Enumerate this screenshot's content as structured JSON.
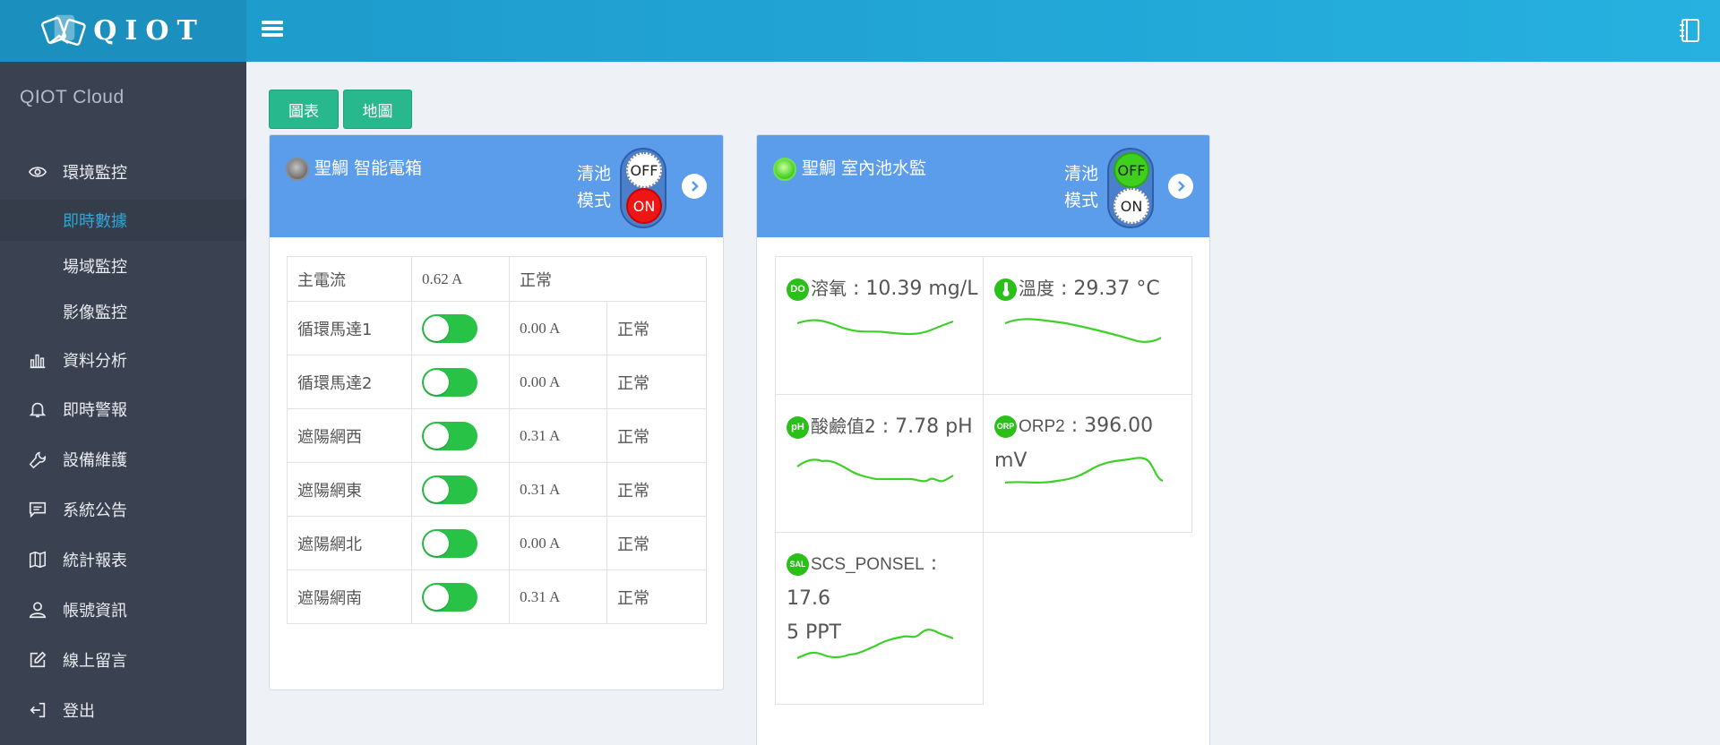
{
  "brand": {
    "name": "QIOT"
  },
  "sidebar": {
    "title": "QIOT Cloud",
    "items": [
      {
        "label": "環境監控",
        "icon": "eye-icon"
      },
      {
        "label": "資料分析",
        "icon": "bar-chart-icon"
      },
      {
        "label": "即時警報",
        "icon": "bell-icon"
      },
      {
        "label": "設備維護",
        "icon": "wrench-icon"
      },
      {
        "label": "系統公告",
        "icon": "message-icon"
      },
      {
        "label": "統計報表",
        "icon": "map-icon"
      },
      {
        "label": "帳號資訊",
        "icon": "user-icon"
      },
      {
        "label": "線上留言",
        "icon": "edit-icon"
      },
      {
        "label": "登出",
        "icon": "logout-icon"
      }
    ],
    "subitems": [
      {
        "label": "即時數據",
        "active": true
      },
      {
        "label": "場域監控",
        "active": false
      },
      {
        "label": "影像監控",
        "active": false
      }
    ]
  },
  "toolbar": {
    "chart_label": "圖表",
    "map_label": "地圖"
  },
  "cards": [
    {
      "title": "聖鯛 智能電箱",
      "status": "gray",
      "mode_label_1": "清池",
      "mode_label_2": "模式",
      "off_label": "OFF",
      "on_label": "ON",
      "main_row": {
        "name": "主電流",
        "value": "0.62 A",
        "status": "正常"
      },
      "rows": [
        {
          "name": "循環馬達1",
          "on": true,
          "value": "0.00 A",
          "status": "正常"
        },
        {
          "name": "循環馬達2",
          "on": true,
          "value": "0.00 A",
          "status": "正常"
        },
        {
          "name": "遮陽網西",
          "on": true,
          "value": "0.31 A",
          "status": "正常"
        },
        {
          "name": "遮陽網東",
          "on": true,
          "value": "0.31 A",
          "status": "正常"
        },
        {
          "name": "遮陽網北",
          "on": true,
          "value": "0.00 A",
          "status": "正常"
        },
        {
          "name": "遮陽網南",
          "on": true,
          "value": "0.31 A",
          "status": "正常"
        }
      ]
    },
    {
      "title": "聖鯛 室內池水監",
      "status": "green",
      "mode_label_1": "清池",
      "mode_label_2": "模式",
      "off_label": "OFF",
      "on_label": "ON",
      "sensors": [
        {
          "badge": "DO",
          "name": "溶氧",
          "value": "10.39 mg/L"
        },
        {
          "badge": "temp",
          "name": "溫度",
          "value": "29.37 °C"
        },
        {
          "badge": "pH",
          "name": "酸鹼值2",
          "value": "7.78 pH"
        },
        {
          "badge": "ORP",
          "name": "ORP2",
          "value": "396.00 mV"
        },
        {
          "badge": "SAL",
          "name": "SCS_PONSEL",
          "value_line1": "17.6",
          "value_line2": "5 PPT"
        }
      ]
    }
  ],
  "colors": {
    "header": "#26b1e0",
    "sidebar": "#3a4150",
    "card_head": "#5b9ceb",
    "accent": "#2ba8d8",
    "button": "#27b88d",
    "toggle": "#28c246",
    "sparkline": "#3fcf2a"
  }
}
